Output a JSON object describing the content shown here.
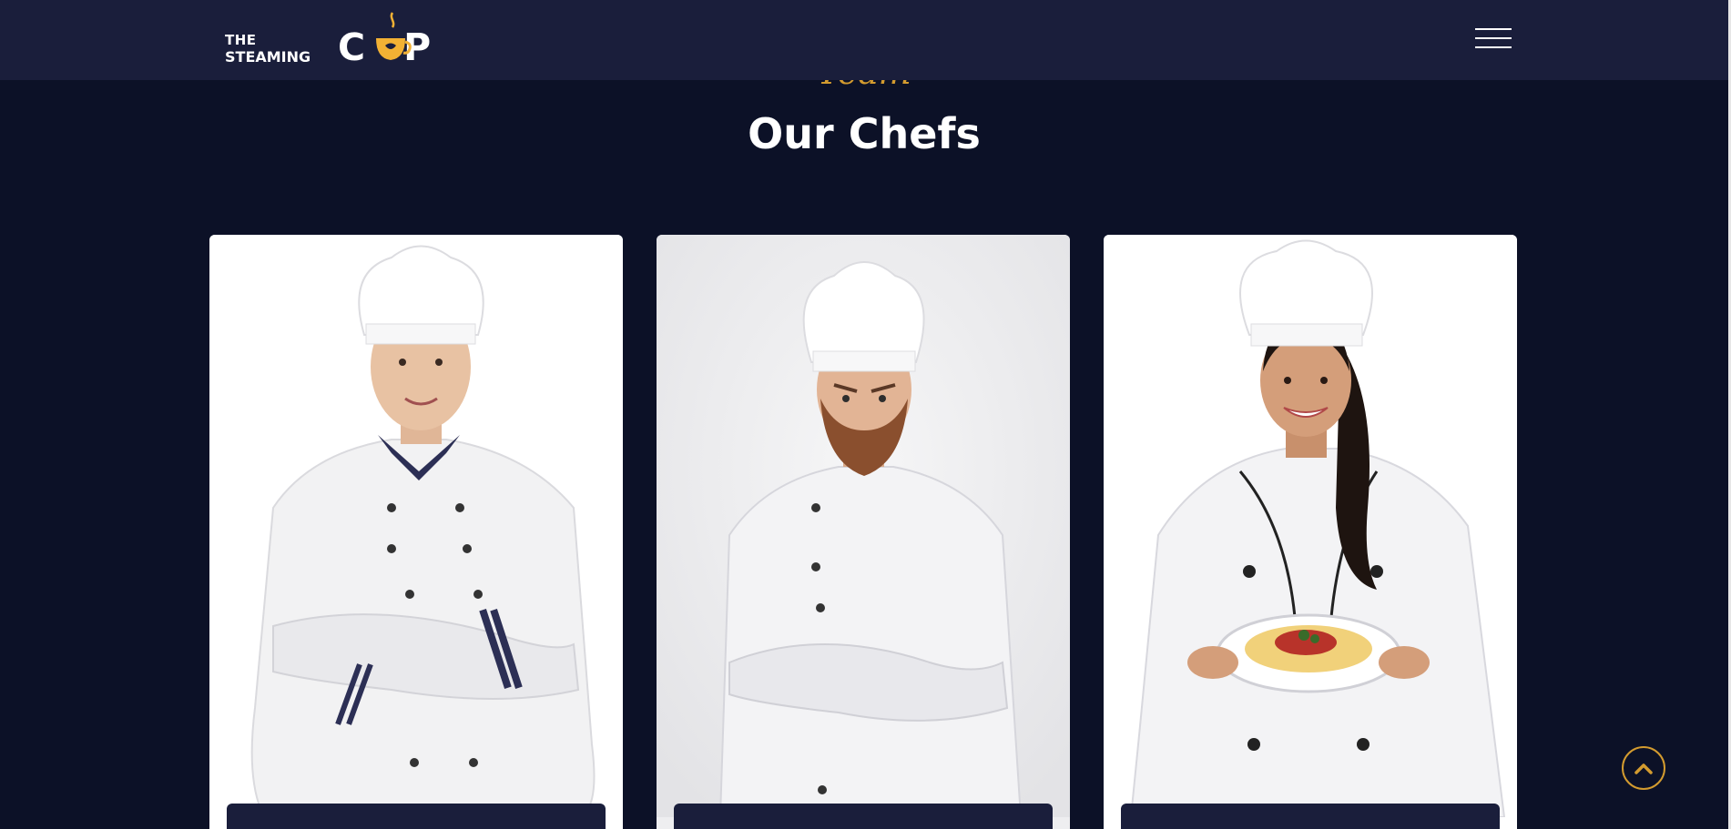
{
  "header": {
    "logo": {
      "word_the": "THE",
      "word_steaming_first": "S",
      "word_steaming_rest": "TEAMING",
      "word_cup_c": "C",
      "word_cup_p": "P",
      "alt": "The Steaming Cup"
    },
    "menu_icon": "hamburger-menu-icon"
  },
  "section": {
    "kicker": "Team",
    "title": "Our Chefs"
  },
  "chefs": [
    {
      "photo": "male-chef-smiling-arms-crossed"
    },
    {
      "photo": "bearded-chef-serious-arms-crossed"
    },
    {
      "photo": "female-chef-holding-pasta-plate"
    }
  ],
  "back_to_top_icon": "chevron-up-icon",
  "colors": {
    "page_bg": "#0c1127",
    "header_bg": "#1a1e3b",
    "accent": "#d39b2f",
    "logo_accent": "#f2b134",
    "nameplate_bg": "#1a1e3b"
  }
}
